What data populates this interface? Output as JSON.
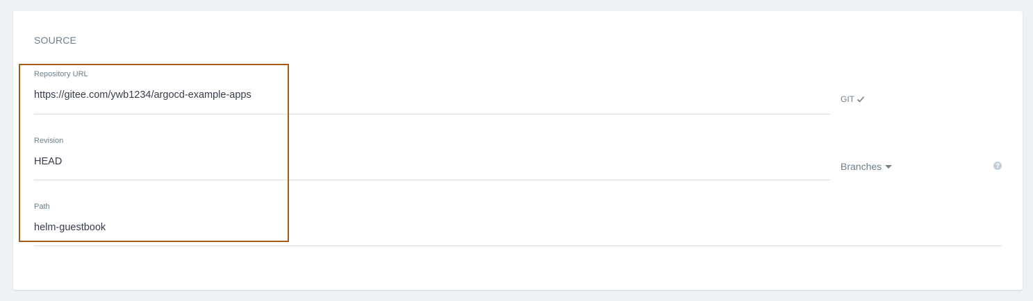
{
  "section": {
    "title": "SOURCE"
  },
  "fields": {
    "repo_url": {
      "label": "Repository URL",
      "value": "https://gitee.com/ywb1234/argocd-example-apps"
    },
    "revision": {
      "label": "Revision",
      "value": "HEAD"
    },
    "path": {
      "label": "Path",
      "value": "helm-guestbook"
    }
  },
  "repo_type": {
    "label": "GIT",
    "icon": "check-icon"
  },
  "revision_type": {
    "label": "Branches",
    "icon": "caret-down-icon"
  },
  "help": {
    "icon": "question-circle-icon",
    "glyph": "?"
  },
  "colors": {
    "highlight_border": "#a35c12",
    "label_text": "#6d7f8b",
    "value_text": "#363c4a",
    "background": "#eef1f5"
  }
}
